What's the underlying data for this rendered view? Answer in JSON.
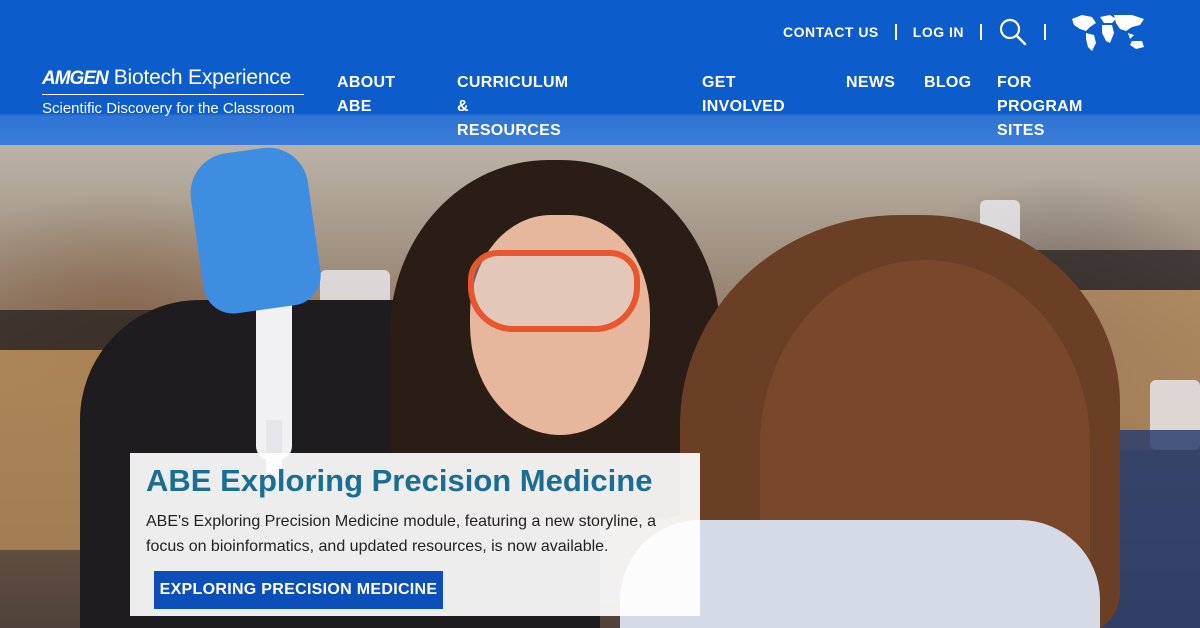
{
  "colors": {
    "header_blue": "#0d5ccb",
    "title_teal": "#1a6e93",
    "button_blue": "#0d4fb8"
  },
  "utility": {
    "contact": "CONTACT US",
    "login": "LOG IN",
    "search_icon": "search-icon",
    "region_icon": "world-map-icon"
  },
  "logo": {
    "brand": "AMGEN",
    "product": "Biotech Experience",
    "tagline": "Scientific Discovery for the Classroom"
  },
  "nav": {
    "items": [
      {
        "label": "ABOUT\nABE"
      },
      {
        "label": "CURRICULUM &\nRESOURCES"
      },
      {
        "label": "GET\nINVOLVED"
      },
      {
        "label": "NEWS"
      },
      {
        "label": "BLOG"
      },
      {
        "label": "FOR PROGRAM\nSITES"
      }
    ]
  },
  "feature": {
    "title": "ABE Exploring Precision Medicine",
    "text": "ABE's Exploring Precision Medicine module, featuring a new storyline, a focus on bioinformatics, and updated resources, is now available.",
    "button": "EXPLORING PRECISION MEDICINE"
  }
}
